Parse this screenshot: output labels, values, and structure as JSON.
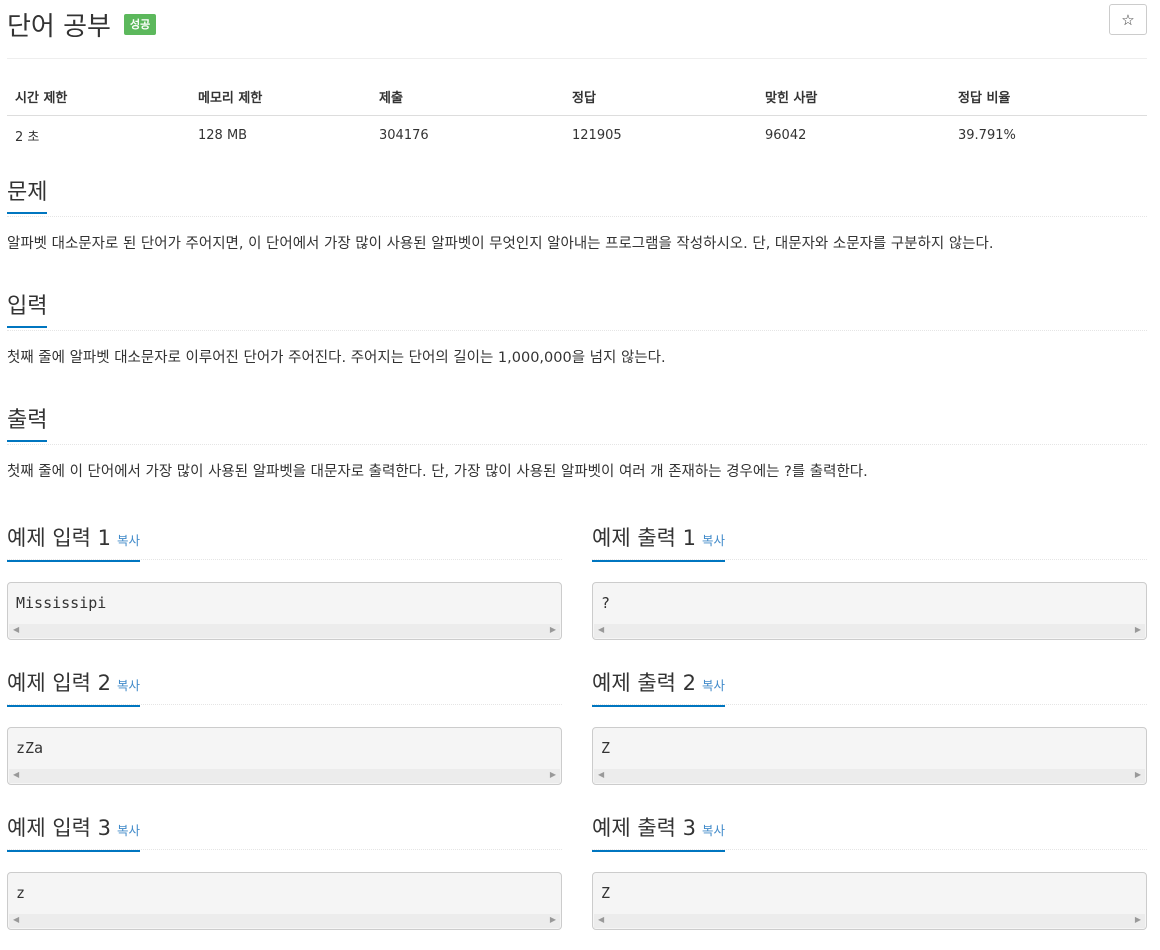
{
  "header": {
    "title": "단어 공부",
    "badge": "성공",
    "star_icon": "☆"
  },
  "stats": {
    "headers": [
      "시간 제한",
      "메모리 제한",
      "제출",
      "정답",
      "맞힌 사람",
      "정답 비율"
    ],
    "values": [
      "2 초",
      "128 MB",
      "304176",
      "121905",
      "96042",
      "39.791%"
    ]
  },
  "sections": {
    "problem": {
      "title": "문제",
      "text": "알파벳 대소문자로 된 단어가 주어지면, 이 단어에서 가장 많이 사용된 알파벳이 무엇인지 알아내는 프로그램을 작성하시오. 단, 대문자와 소문자를 구분하지 않는다."
    },
    "input": {
      "title": "입력",
      "text": "첫째 줄에 알파벳 대소문자로 이루어진 단어가 주어진다. 주어지는 단어의 길이는 1,000,000을 넘지 않는다."
    },
    "output": {
      "title": "출력",
      "text": "첫째 줄에 이 단어에서 가장 많이 사용된 알파벳을 대문자로 출력한다. 단, 가장 많이 사용된 알파벳이 여러 개 존재하는 경우에는 ?를 출력한다."
    }
  },
  "samples": {
    "copy_label": "복사",
    "items": [
      {
        "in_title": "예제 입력 1",
        "in_value": "Mississipi",
        "out_title": "예제 출력 1",
        "out_value": "?"
      },
      {
        "in_title": "예제 입력 2",
        "in_value": "zZa",
        "out_title": "예제 출력 2",
        "out_value": "Z"
      },
      {
        "in_title": "예제 입력 3",
        "in_value": "z",
        "out_title": "예제 출력 3",
        "out_value": "Z"
      }
    ]
  },
  "colors": {
    "accent": "#0076c0",
    "success": "#5cb85c",
    "link": "#428bca"
  },
  "icons": {
    "scroll_left": "scroll-left-arrow-icon",
    "scroll_right": "scroll-right-arrow-icon"
  }
}
